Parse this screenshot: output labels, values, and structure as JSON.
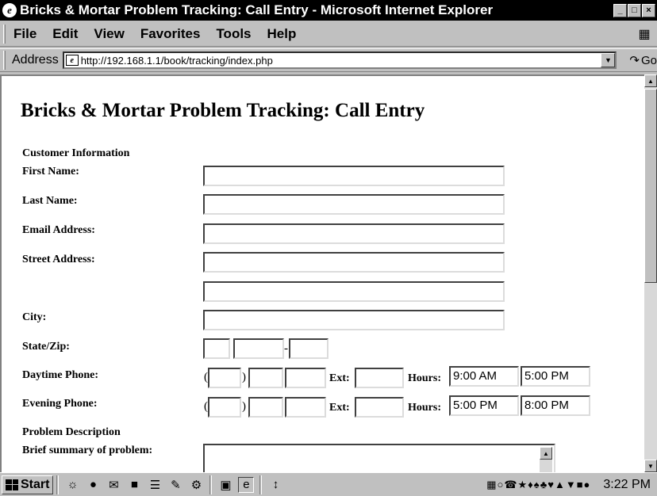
{
  "window": {
    "title": "Bricks & Mortar Problem Tracking: Call Entry - Microsoft Internet Explorer",
    "minimize": "_",
    "maximize": "□",
    "close": "×"
  },
  "menu": {
    "file": "File",
    "edit": "Edit",
    "view": "View",
    "favorites": "Favorites",
    "tools": "Tools",
    "help": "Help"
  },
  "address": {
    "label": "Address",
    "url": "http://192.168.1.1/book/tracking/index.php",
    "go": "Go"
  },
  "form": {
    "heading": "Bricks & Mortar Problem Tracking: Call Entry",
    "customer_section": "Customer Information",
    "first_name_label": "First Name:",
    "last_name_label": "Last Name:",
    "email_label": "Email Address:",
    "street_label": "Street Address:",
    "city_label": "City:",
    "state_zip_label": "State/Zip:",
    "day_phone_label": "Daytime Phone:",
    "eve_phone_label": "Evening Phone:",
    "ext_label": "Ext:",
    "hours_label": "Hours:",
    "open_paren": "(",
    "close_paren": ")",
    "zip_dash": "-",
    "day_hours_from": "9:00 AM",
    "day_hours_to": "5:00 PM",
    "eve_hours_from": "5:00 PM",
    "eve_hours_to": "8:00 PM",
    "problem_section": "Problem Description",
    "summary_label": "Brief summary of problem:",
    "first_name": "",
    "last_name": "",
    "email": "",
    "street1": "",
    "street2": "",
    "city": "",
    "state": "",
    "zip": "",
    "zip4": ""
  },
  "taskbar": {
    "start": "Start",
    "clock": "3:22 PM"
  }
}
